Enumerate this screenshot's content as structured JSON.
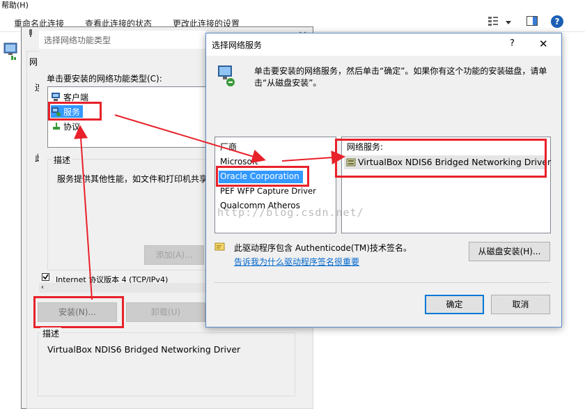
{
  "explorer": {
    "menu_help": "帮助(H)",
    "commands": [
      "重命名此连接",
      "查看此连接的状态",
      "更改此连接的设置"
    ],
    "help_glyph": "?"
  },
  "feature_dialog": {
    "title": "选择网络功能类型",
    "close_glyph": "×",
    "prompt": "单击要安装的网络功能类型(C):",
    "types": [
      "客户端",
      "服务",
      "协议"
    ],
    "selected_index": 1,
    "desc_group_label": "描述",
    "desc_text": "服务提供其他性能，如文件和打印机共享",
    "add_button": "添加(A)...",
    "partial_left_a": "网",
    "partial_left_b": "连",
    "partial_left_c": "此",
    "protocol_item": "Internet 协议版本 4 (TCP/IPv4)",
    "install_button": "安装(N)...",
    "uninstall_button": "卸载(U)",
    "bottom_desc_label": "描述",
    "bottom_desc_text": "VirtualBox NDIS6 Bridged Networking Driver"
  },
  "service_dialog": {
    "title": "选择网络服务",
    "help_glyph": "?",
    "close_glyph": "✕",
    "instruction": "单击要安装的网络服务，然后单击“确定”。如果你有这个功能的安装磁盘，请单击“从磁盘安装”。",
    "manufacturer_header": "厂商",
    "manufacturers": [
      "Microsoft",
      "Oracle Corporation",
      "PEF WFP Capture Driver",
      "Qualcomm Atheros"
    ],
    "selected_manufacturer": 1,
    "service_header": "网络服务:",
    "services": [
      "VirtualBox NDIS6 Bridged Networking Driver"
    ],
    "signed_text": "此驱动程序包含 Authenticode(TM)技术签名。",
    "signed_link": "告诉我为什么驱动程序签名很重要",
    "have_disk_button": "从磁盘安装(H)...",
    "ok_button": "确定",
    "cancel_button": "取消"
  },
  "watermark": "http://blog.csdn.net/"
}
